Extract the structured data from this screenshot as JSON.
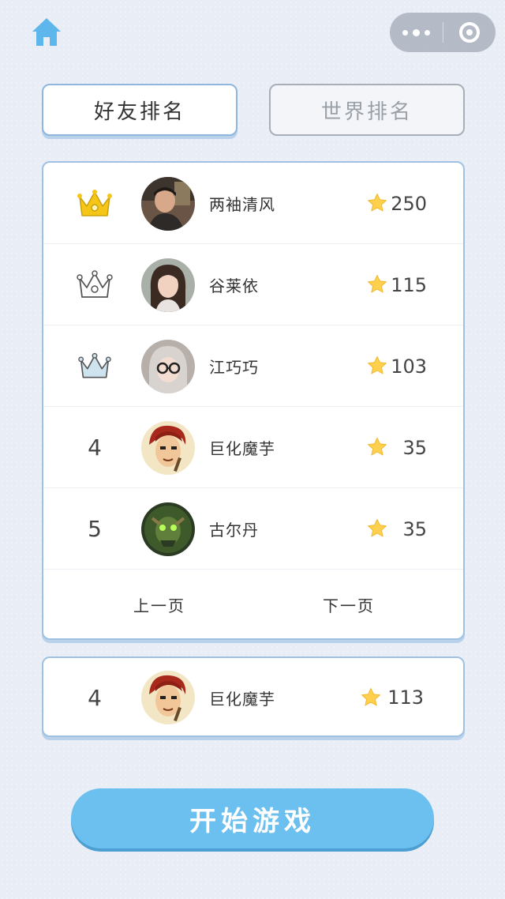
{
  "icons": {
    "home": "home-icon",
    "more": "more-icon",
    "close": "close-target-icon",
    "gold_crown": "crown-gold-icon",
    "silver_crown": "crown-outline-icon",
    "bronze_crown": "crown-blue-icon",
    "star": "star-icon"
  },
  "colors": {
    "accent": "#6cc0ef",
    "border": "#9fc2e2",
    "star": "#ffd04d",
    "gold": "#f5c518"
  },
  "tabs": {
    "friends": "好友排名",
    "world": "世界排名"
  },
  "leaderboard": {
    "rows": [
      {
        "rank": "",
        "name": "两袖清风",
        "score": "250"
      },
      {
        "rank": "",
        "name": "谷莱依",
        "score": "115"
      },
      {
        "rank": "",
        "name": "江巧巧",
        "score": "103"
      },
      {
        "rank": "4",
        "name": "巨化魔芋",
        "score": "35"
      },
      {
        "rank": "5",
        "name": "古尔丹",
        "score": "35"
      }
    ],
    "prev": "上一页",
    "next": "下一页"
  },
  "me": {
    "rank": "4",
    "name": "巨化魔芋",
    "score": "113"
  },
  "start_button": "开始游戏"
}
